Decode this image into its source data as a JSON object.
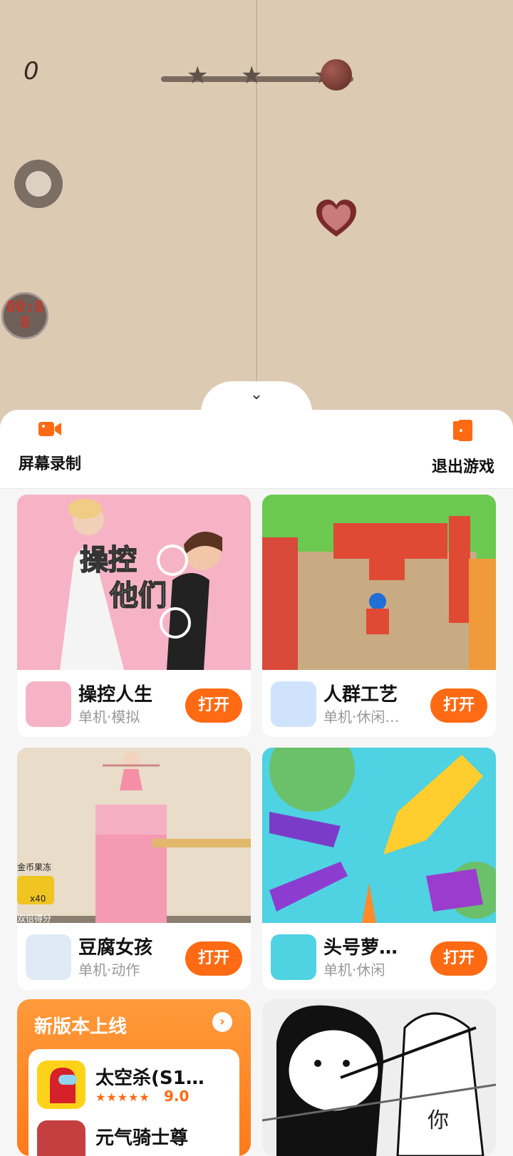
{
  "game": {
    "score": "0",
    "timer_line1": "00:0",
    "timer_line2": "0",
    "stars_total": 3
  },
  "sheet": {
    "record_label": "屏幕录制",
    "exit_label": "退出游戏"
  },
  "games": [
    {
      "title": "操控人生",
      "subtitle": "单机·模拟",
      "button": "打开",
      "thumb_text": "操控\n他们"
    },
    {
      "title": "人群工艺",
      "subtitle": "单机·休闲…",
      "button": "打开"
    },
    {
      "title": "豆腐女孩",
      "subtitle": "单机·动作",
      "button": "打开",
      "thumb_text_1": "金币果冻",
      "thumb_text_2": "x40",
      "thumb_text_3": "双倍得分"
    },
    {
      "title": "头号萝…",
      "subtitle": "单机·休闲",
      "button": "打开"
    }
  ],
  "promo": {
    "title": "新版本上线",
    "game_title": "太空杀(S1…",
    "rating": "9.0",
    "stars": "★★★★★",
    "game2_title": "元气骑士尊"
  },
  "comic": {
    "text": "你"
  },
  "colors": {
    "accent": "#ff6a13",
    "game_bg": "#dccab3"
  }
}
